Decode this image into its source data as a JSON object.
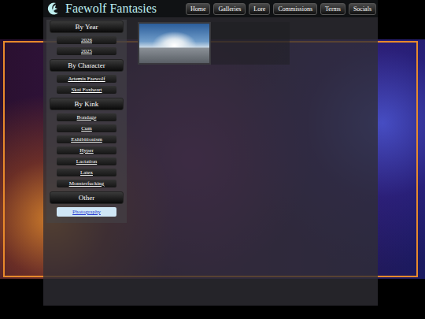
{
  "site": {
    "title": "Faewolf Fantasies"
  },
  "nav": [
    "Home",
    "Galleries",
    "Lore",
    "Commissions",
    "Terms",
    "Socials"
  ],
  "sidebar": {
    "sections": [
      {
        "heading": "By Year",
        "items": [
          {
            "label": "2026",
            "selected": false
          },
          {
            "label": "2025",
            "selected": false
          }
        ]
      },
      {
        "heading": "By Character",
        "items": [
          {
            "label": "Artemis Faewolf",
            "selected": false
          },
          {
            "label": "Skai Foxheart",
            "selected": false
          }
        ]
      },
      {
        "heading": "By Kink",
        "items": [
          {
            "label": "Bondage",
            "selected": false
          },
          {
            "label": "Cum",
            "selected": false
          },
          {
            "label": "Exhibitionism",
            "selected": false
          },
          {
            "label": "Hyper",
            "selected": false
          },
          {
            "label": "Lactation",
            "selected": false
          },
          {
            "label": "Latex",
            "selected": false
          },
          {
            "label": "Monsterfucking",
            "selected": false
          }
        ]
      },
      {
        "heading": "Other",
        "items": [
          {
            "label": "Photography",
            "selected": true
          }
        ]
      }
    ]
  }
}
